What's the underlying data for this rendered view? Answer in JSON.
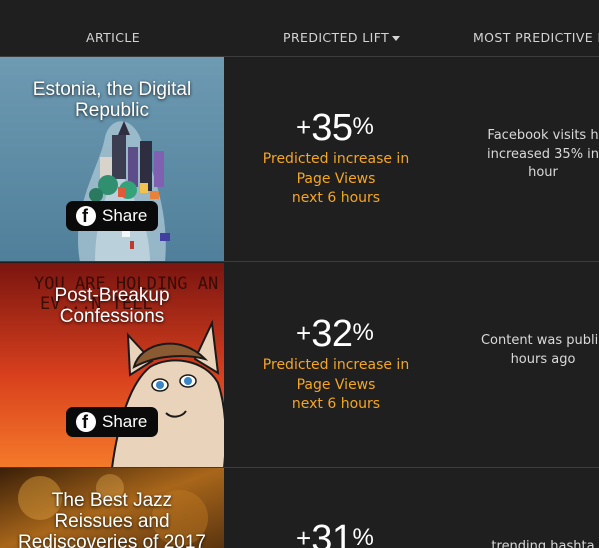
{
  "header": {
    "article": "ARTICLE",
    "predicted_lift": "PREDICTED LIFT",
    "most_predictive": "MOST PREDICTIVE FA"
  },
  "rows": [
    {
      "title_line1": "Estonia, the Digital",
      "title_line2": "Republic",
      "share_label": "Share",
      "lift_sign": "+",
      "lift_number": "35",
      "lift_pct": "%",
      "desc_line1": "Predicted increase in",
      "desc_line2": "Page Views",
      "desc_line3": "next 6 hours",
      "factor_line1": "Facebook visits h",
      "factor_line2": "increased 35% in",
      "factor_line3": "hour"
    },
    {
      "title_line1": "Post-Breakup",
      "title_line2": "Confessions",
      "share_label": "Share",
      "image_text_line1": "YOU ARE HOLDING AN",
      "image_text_line2": "EV...N TELL",
      "lift_sign": "+",
      "lift_number": "32",
      "lift_pct": "%",
      "desc_line1": "Predicted increase in",
      "desc_line2": "Page Views",
      "desc_line3": "next 6 hours",
      "factor_line1": "Content was publis",
      "factor_line2": "hours ago"
    },
    {
      "title_line1": "The Best Jazz",
      "title_line2": "Reissues and",
      "title_line3": "Rediscoveries of 2017",
      "lift_sign": "+",
      "lift_number": "31",
      "lift_pct": "%",
      "factor_line1": "trending hashta"
    }
  ],
  "colors": {
    "background": "#1f1f1f",
    "accent": "#f5a623",
    "divider": "#3c3c3c"
  }
}
